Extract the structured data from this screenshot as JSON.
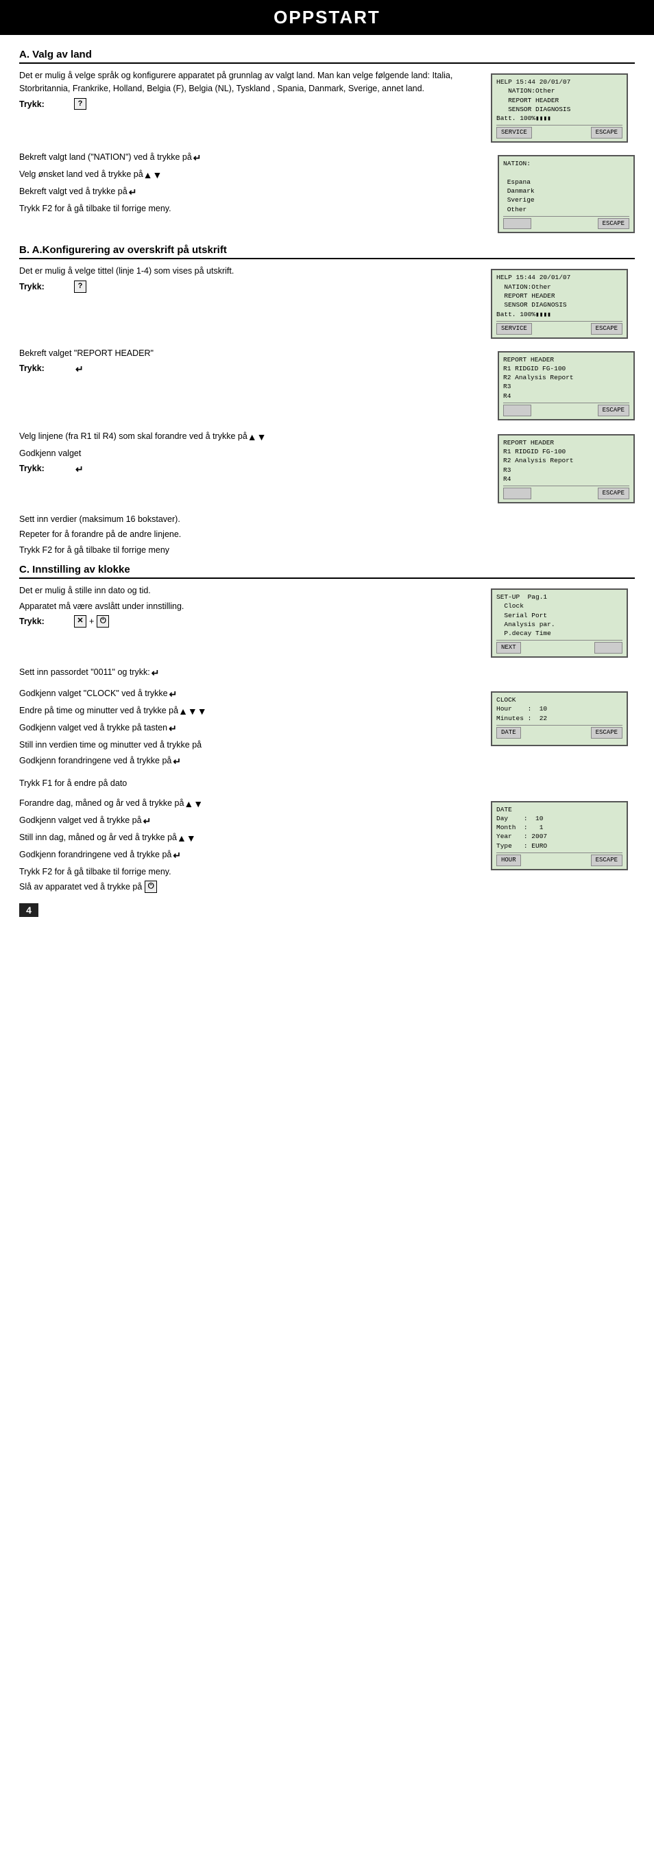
{
  "page": {
    "title": "OPPSTART",
    "page_number": "4"
  },
  "section_a": {
    "title": "A. Valg av land",
    "body1": "Det er mulig å velge språk og konfigurere apparatet på grunnlag av valgt land. Man kan velge følgende land: Italia, Storbritannia, Frankrike, Holland, Belgia (F), Belgia (NL), Tyskland , Spania, Danmark, Sverige, annet land.",
    "trykk_label": "Trykk:",
    "trykk_symbol": "?",
    "inst1": "Bekreft valgt land (\"NATION\") ved å trykke på",
    "inst2": "Velg ønsket land ved å trykke på",
    "inst3": "Bekreft valgt ved å trykke på",
    "inst4": "Trykk F2 for å gå tilbake til forrige meny.",
    "screen1": {
      "lines": [
        "HELP 15:44 20/01/07",
        "   NATION:Other",
        "   REPORT HEADER",
        "   SENSOR DIAGNOSIS",
        "Batt. 100%"
      ],
      "btn_left": "SERVICE",
      "btn_right": "ESCAPE"
    },
    "screen2": {
      "lines": [
        "NATION:",
        "",
        " Espana",
        " Danmark",
        " Sverige",
        " Other"
      ],
      "btn_left": "",
      "btn_right": "ESCAPE"
    }
  },
  "section_b": {
    "title": "B. A.Konfigurering av overskrift på utskrift",
    "body1": "Det er mulig å velge tittel (linje 1-4) som vises på utskrift.",
    "trykk_label": "Trykk:",
    "trykk_symbol": "?",
    "inst1": "Bekreft valget \"REPORT HEADER\"",
    "trykk2_label": "Trykk:",
    "screen1": {
      "lines": [
        "HELP 15:44 20/01/07",
        "  NATION:Other",
        "  REPORT HEADER",
        "  SENSOR DIAGNOSIS",
        "Batt. 100%"
      ],
      "btn_left": "SERVICE",
      "btn_right": "ESCAPE"
    },
    "screen2": {
      "lines": [
        "REPORT HEADER",
        "R1 RIDGID FG-100",
        "R2 Analysis Report",
        "R3",
        "R4"
      ],
      "btn_left": "",
      "btn_right": "ESCAPE"
    },
    "inst2": "Velg linjene (fra R1 til R4) som skal forandre ved å trykke på",
    "inst3": "Godkjenn valget",
    "trykk3_label": "Trykk:",
    "screen3": {
      "lines": [
        "REPORT HEADER",
        "R1 RIDGID FG-100",
        "R2 Analysis Report",
        "R3",
        "R4"
      ],
      "btn_left": "",
      "btn_right": "ESCAPE"
    },
    "inst4": "Sett inn verdier (maksimum 16 bokstaver).",
    "inst5": "Repeter for å forandre på de andre linjene.",
    "inst6": "Trykk F2 for å gå tilbake til forrige meny"
  },
  "section_c": {
    "title": "C. Innstilling av klokke",
    "body1": "Det er mulig å stille inn dato og tid.",
    "body2": "Apparatet må være avslått under innstilling.",
    "trykk_label": "Trykk:",
    "trykk_symbols": [
      "✕",
      "+",
      "⏻"
    ],
    "inst1": "Sett inn passordet \"0011\" og trykk:",
    "inst2": "Godkjenn valget \"CLOCK\" ved å trykke",
    "inst3": "Endre på time og minutter ved å trykke på",
    "inst4": "Godkjenn valget ved å trykke på tasten",
    "inst5": "Still inn verdien time og minutter ved å trykke på",
    "inst6": "Godkjenn forandringene ved å trykke på",
    "inst7": "Trykk F1 for å endre på dato",
    "inst8": "Forandre dag, måned og år ved å trykke på",
    "inst9": "Godkjenn valget ved å trykke på",
    "inst10": "Still inn dag, måned og år ved å trykke på",
    "inst11": "Godkjenn forandringene ved å trykke på",
    "inst12": "Trykk F2 for å gå tilbake til forrige meny.",
    "inst13": "Slå av apparatet ved å trykke på",
    "screen1": {
      "title": "SET-UP  Pag.1",
      "lines": [
        "SET-UP  Pag.1",
        "  Clock",
        "  Serial Port",
        "  Analysis par.",
        "  P.decay Time"
      ],
      "btn_left": "NEXT",
      "btn_right": ""
    },
    "screen2": {
      "title": "CLOCK",
      "lines": [
        "CLOCK",
        "Hour    :  10",
        "Minutes :  22"
      ],
      "btn_left": "DATE",
      "btn_right": "ESCAPE"
    },
    "screen3": {
      "title": "DATE",
      "lines": [
        "DATE",
        "Day    :  10",
        "Month  :   1",
        "Year   : 2007",
        "Type   : EURO"
      ],
      "btn_left": "HOUR",
      "btn_right": "ESCAPE"
    }
  }
}
